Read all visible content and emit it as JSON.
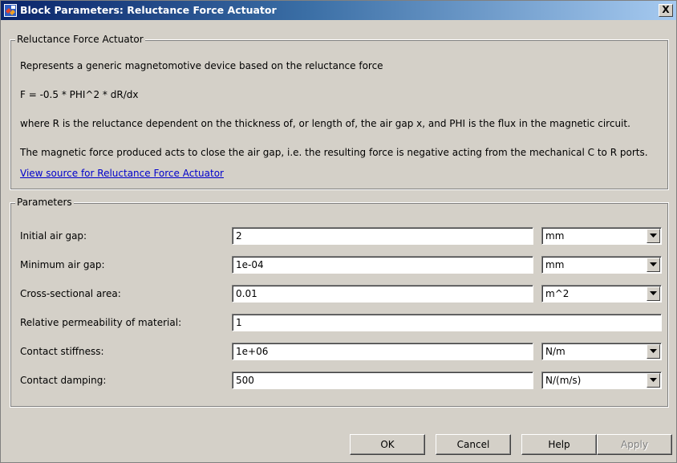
{
  "window": {
    "title": "Block Parameters: Reluctance Force Actuator",
    "close_glyph": "X",
    "icon": "simulink-block-icon"
  },
  "description": {
    "group_title": "Reluctance Force Actuator",
    "lines": [
      "Represents a generic magnetomotive device based on the reluctance force",
      "F = -0.5 * PHI^2 * dR/dx",
      "where R is the reluctance dependent on the thickness of, or length of, the air gap x, and PHI is the flux in the magnetic circuit.",
      "The magnetic force produced acts to close the air gap, i.e. the resulting force is negative acting from the mechanical C to R ports."
    ],
    "link": "View source for Reluctance Force Actuator"
  },
  "parameters": {
    "group_title": "Parameters",
    "rows": [
      {
        "label": "Initial air gap:",
        "value": "2",
        "unit": "mm"
      },
      {
        "label": "Minimum air gap:",
        "value": "1e-04",
        "unit": "mm"
      },
      {
        "label": "Cross-sectional area:",
        "value": "0.01",
        "unit": "m^2"
      },
      {
        "label": "Relative permeability of material:",
        "value": "1",
        "unit": null
      },
      {
        "label": "Contact stiffness:",
        "value": "1e+06",
        "unit": "N/m"
      },
      {
        "label": "Contact damping:",
        "value": "500",
        "unit": "N/(m/s)"
      }
    ]
  },
  "buttons": {
    "ok": "OK",
    "cancel": "Cancel",
    "help": "Help",
    "apply": "Apply",
    "apply_enabled": false
  },
  "colors": {
    "dialog_background": "#d4d0c8",
    "title_gradient_start": "#0a246a",
    "title_gradient_end": "#a6caf0",
    "link": "#0000cc"
  }
}
